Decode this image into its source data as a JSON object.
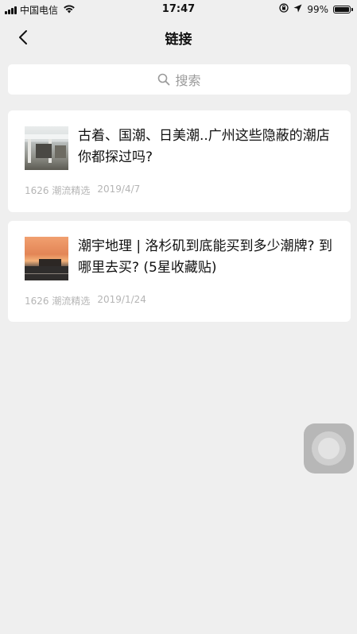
{
  "status_bar": {
    "carrier": "中国电信",
    "time": "17:47",
    "battery": "99%",
    "battery_level": 0.99,
    "icons": [
      "signal-icon",
      "wifi-icon",
      "orientation-lock-icon",
      "location-icon",
      "battery-icon"
    ]
  },
  "nav": {
    "back_icon": "chevron-left-icon",
    "title": "链接"
  },
  "search": {
    "icon": "search-icon",
    "placeholder": "搜索"
  },
  "articles": [
    {
      "title": "古着、国潮、日美潮..广州这些隐蔽的潮店你都探过吗?",
      "source": "1626 潮流精选",
      "date": "2019/4/7"
    },
    {
      "title": "潮宇地理 | 洛杉矶到底能买到多少潮牌? 到哪里去买? (5星收藏贴)",
      "source": "1626 潮流精选",
      "date": "2019/1/24"
    }
  ],
  "floating_button": {
    "icon": "assistive-touch-icon"
  }
}
